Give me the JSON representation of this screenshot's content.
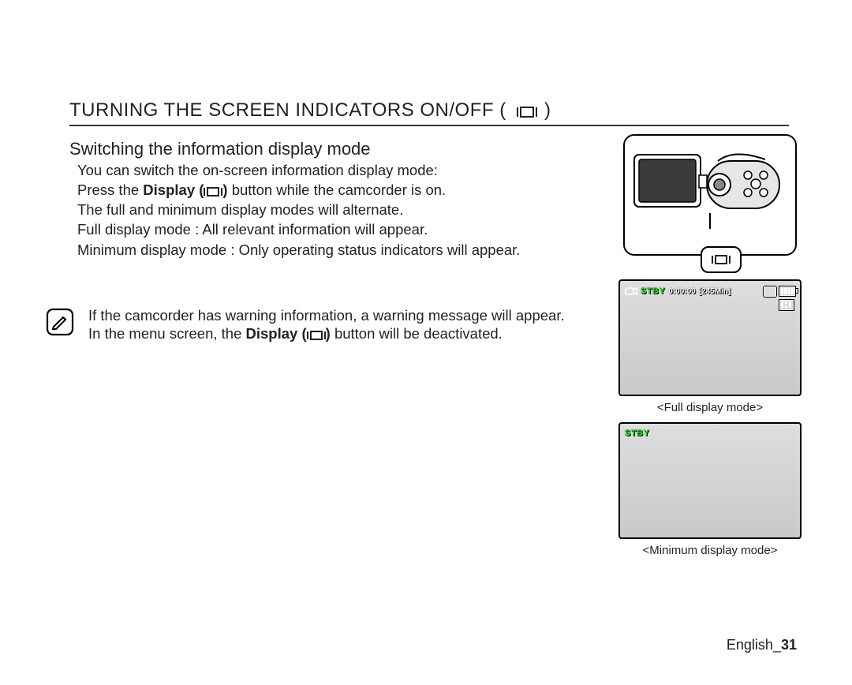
{
  "heading": "TURNING THE SCREEN INDICATORS ON/OFF (",
  "heading_close": " )",
  "subheading": "Switching the information display mode",
  "body": {
    "line1": "You can switch the on-screen information display mode:",
    "line2a": "Press the ",
    "display_label": "Display (",
    "display_close": ")",
    "line2b": " button while the camcorder is on.",
    "line3": "The full and minimum display modes will alternate.",
    "full_label": "Full display mode",
    "full_sep": " : ",
    "full_desc": "All relevant information will appear.",
    "min_label": "Minimum display mode",
    "min_sep": "  : ",
    "min_desc": "Only operating status indicators will appear."
  },
  "note": {
    "line1": "If the camcorder has warning information, a warning message will appear.",
    "line2a": "In the menu screen, the ",
    "display_label": "Display (",
    "display_close": ")",
    "line2b": " button will be deactivated."
  },
  "screens": {
    "stby": "STBY",
    "time": "0:00:00",
    "remain": "[245Min]",
    "full_caption": "<Full display mode>",
    "min_caption": "<Minimum display mode>"
  },
  "footer": {
    "lang": "English",
    "sep": "_",
    "page": "31"
  }
}
